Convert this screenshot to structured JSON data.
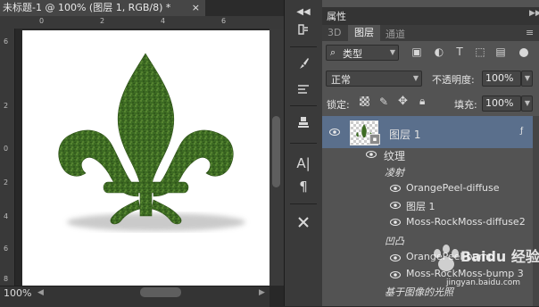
{
  "document": {
    "tab_title": "未标题-1 @ 100% (图层 1, RGB/8) *",
    "close_glyph": "×",
    "zoom": "100%",
    "ruler_top": [
      "0",
      "2",
      "4",
      "6"
    ],
    "ruler_left": [
      "6",
      "2",
      "0",
      "2",
      "4",
      "6",
      "8"
    ]
  },
  "panel": {
    "properties_tab": "属性",
    "tabs": [
      "3D",
      "图层",
      "通道"
    ],
    "filter_kind": "类型",
    "blend_mode": "正常",
    "opacity_label": "不透明度:",
    "opacity_value": "100%",
    "lock_label": "锁定:",
    "fill_label": "填充:",
    "fill_value": "100%",
    "layer_name": "图层 1",
    "effects_label": "纹理",
    "group_bevel": "凌射",
    "effects": [
      {
        "name": "OrangePeel-diffuse"
      },
      {
        "name": "图层 1"
      },
      {
        "name": "Moss-RockMoss-diffuse2"
      }
    ],
    "group_bump": "凹凸",
    "effects2": [
      {
        "name": "OrangePeel-bump"
      },
      {
        "name": "Moss-RockMoss-bump 3"
      }
    ],
    "bottom_label": "基于图像的光照"
  },
  "watermark": {
    "text": "Baidu 经验",
    "sub": "jingyan.baidu.com"
  },
  "colors": {
    "bg_dark": "#282828",
    "panel": "#535353",
    "selected_row": "#5a6f8c",
    "moss": "#3d6b23"
  }
}
